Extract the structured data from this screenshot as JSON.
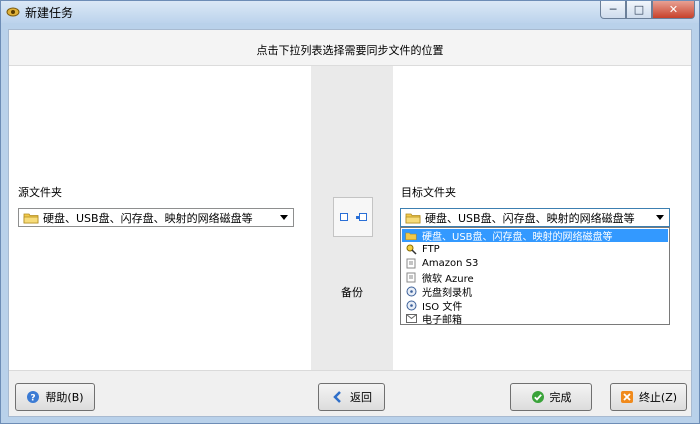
{
  "window": {
    "title": "新建任务",
    "controls": {
      "minimize": "─",
      "maximize": "□",
      "close": "✕"
    }
  },
  "header": {
    "instruction": "点击下拉列表选择需要同步文件的位置"
  },
  "source": {
    "label": "源文件夹",
    "selected": "硬盘、USB盘、闪存盘、映射的网络磁盘等"
  },
  "center": {
    "action_label": "备份"
  },
  "target": {
    "label": "目标文件夹",
    "selected": "硬盘、USB盘、闪存盘、映射的网络磁盘等",
    "options": [
      {
        "label": "硬盘、USB盘、闪存盘、映射的网络磁盘等",
        "icon": "folder-icon",
        "selected": true
      },
      {
        "label": "FTP",
        "icon": "ftp-icon",
        "selected": false
      },
      {
        "label": "Amazon S3",
        "icon": "cloud-doc-icon",
        "selected": false
      },
      {
        "label": "微软 Azure",
        "icon": "cloud-doc-icon",
        "selected": false
      },
      {
        "label": "光盘刻录机",
        "icon": "disc-icon",
        "selected": false
      },
      {
        "label": "ISO 文件",
        "icon": "disc-icon",
        "selected": false
      },
      {
        "label": "电子邮箱",
        "icon": "mail-icon",
        "selected": false
      }
    ]
  },
  "footer": {
    "help_label": "帮助(B)",
    "back_label": "返回",
    "finish_label": "完成",
    "abort_label": "终止(Z)"
  },
  "colors": {
    "selection": "#3399ff",
    "window_frame": "#b9d1ea",
    "folder": "#f2c94c",
    "help_icon": "#3b7bd4",
    "back_icon": "#2f6fc9",
    "finish_icon": "#3aa33a",
    "abort_icon": "#f08a1c"
  }
}
